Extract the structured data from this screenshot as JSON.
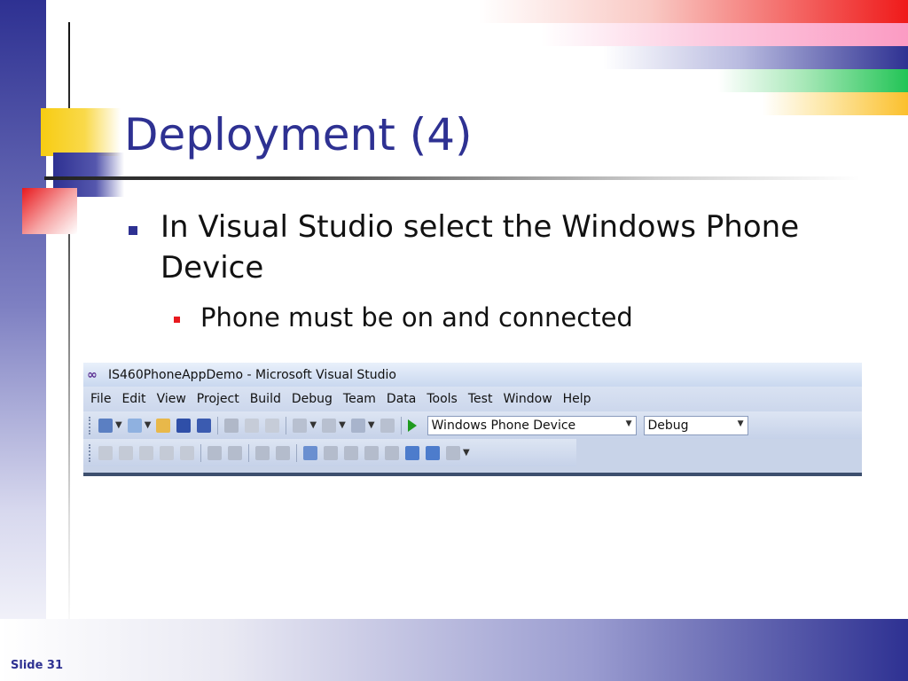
{
  "slide": {
    "title": "Deployment (4)",
    "bullet1": "In Visual Studio select the Windows Phone Device",
    "bullet2": "Phone must be on and connected",
    "slide_number": "Slide 31"
  },
  "vs": {
    "window_title": "IS460PhoneAppDemo - Microsoft Visual Studio",
    "menu": [
      "File",
      "Edit",
      "View",
      "Project",
      "Build",
      "Debug",
      "Team",
      "Data",
      "Tools",
      "Test",
      "Window",
      "Help"
    ],
    "deploy_target": "Windows Phone Device",
    "configuration": "Debug",
    "icons_row1": [
      "new-project-icon",
      "add-item-icon",
      "open-folder-icon",
      "save-icon",
      "save-all-icon",
      "cut-icon",
      "copy-icon",
      "paste-icon",
      "undo-icon",
      "redo-icon",
      "navigate-icon",
      "output-icon",
      "start-debugging-icon"
    ],
    "icons_row2": [
      "toolbar-icon-1",
      "toolbar-icon-2",
      "toolbar-icon-3",
      "font-icon",
      "list-icon",
      "outdent-icon",
      "indent-icon",
      "comment-icon",
      "uncomment-icon",
      "bookmark-icon",
      "prev-bookmark-icon",
      "next-bookmark-icon",
      "prev-folder-bookmark-icon",
      "next-folder-bookmark-icon",
      "prev-doc-bookmark-icon",
      "next-doc-bookmark-icon",
      "clear-bookmarks-icon"
    ]
  }
}
